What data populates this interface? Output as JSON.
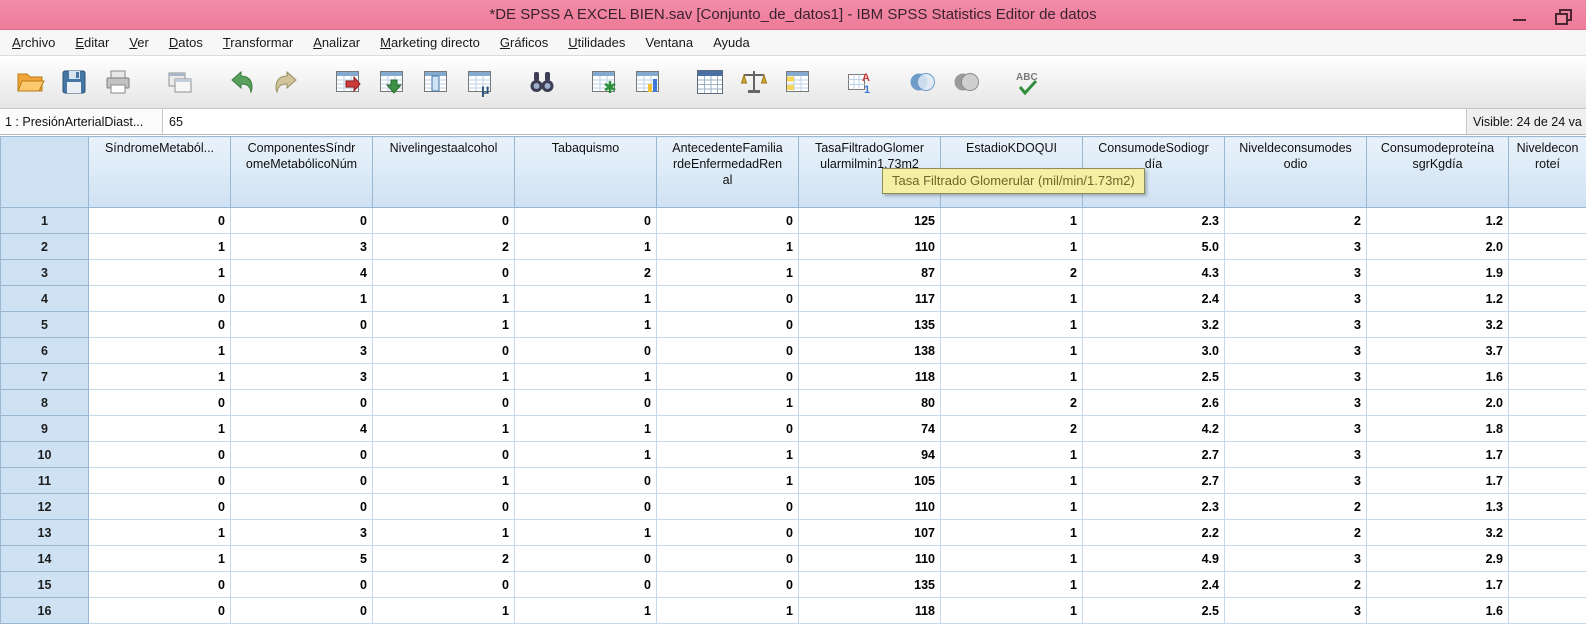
{
  "window": {
    "title": "*DE SPSS A EXCEL BIEN.sav [Conjunto_de_datos1] - IBM SPSS Statistics Editor de datos"
  },
  "menu": {
    "items": [
      {
        "label": "Archivo",
        "underline": true
      },
      {
        "label": "Editar",
        "underline": true
      },
      {
        "label": "Ver",
        "underline": true
      },
      {
        "label": "Datos",
        "underline": true
      },
      {
        "label": "Transformar",
        "underline": true
      },
      {
        "label": "Analizar",
        "underline": true
      },
      {
        "label": "Marketing directo",
        "underline": true
      },
      {
        "label": "Gráficos",
        "underline": true
      },
      {
        "label": "Utilidades",
        "underline": true
      },
      {
        "label": "Ventana",
        "underline": false
      },
      {
        "label": "Ayuda",
        "underline": false
      }
    ]
  },
  "toolbar": {
    "icons": [
      {
        "name": "open-data-icon",
        "gap": false
      },
      {
        "name": "save-icon",
        "gap": false
      },
      {
        "name": "print-icon",
        "gap": false
      },
      {
        "name": "recall-dialogs-icon",
        "gap": true
      },
      {
        "name": "undo-icon",
        "gap": true
      },
      {
        "name": "redo-icon",
        "gap": false
      },
      {
        "name": "goto-case-icon",
        "gap": true
      },
      {
        "name": "goto-variable-icon",
        "gap": false
      },
      {
        "name": "variables-icon",
        "gap": false
      },
      {
        "name": "descriptives-icon",
        "gap": false
      },
      {
        "name": "find-icon",
        "gap": true
      },
      {
        "name": "insert-cases-icon",
        "gap": true
      },
      {
        "name": "insert-variable-icon",
        "gap": false
      },
      {
        "name": "split-file-icon",
        "gap": true
      },
      {
        "name": "weight-cases-icon",
        "gap": false
      },
      {
        "name": "value-labels-icon",
        "gap": false
      },
      {
        "name": "use-variable-sets-icon",
        "gap": true
      },
      {
        "name": "select-cases-icon",
        "gap": true
      },
      {
        "name": "aggregate-icon",
        "gap": false
      },
      {
        "name": "spell-check-icon",
        "gap": true
      }
    ]
  },
  "cell_reference": {
    "label": "1 : PresiónArterialDiast...",
    "value": "65",
    "visible_info": "Visible: 24 de 24 va"
  },
  "tooltip": {
    "text": "Tasa Filtrado Glomerular (mil/min/1.73m2)"
  },
  "grid": {
    "columns": [
      {
        "name": "SíndromeMetabólico",
        "lines": [
          "SíndromeMetaból..."
        ]
      },
      {
        "name": "ComponentesSíndromeMetabólicoNúm",
        "lines": [
          "ComponentesSíndr",
          "omeMetabólicoNúm"
        ]
      },
      {
        "name": "Nivelingestaalcohol",
        "lines": [
          "Nivelingestaalcohol"
        ]
      },
      {
        "name": "Tabaquismo",
        "lines": [
          "Tabaquismo"
        ]
      },
      {
        "name": "AntecedenteFamiliardeEnfermedadRenal",
        "lines": [
          "AntecedenteFamilia",
          "rdeEnfermedadRen",
          "al"
        ]
      },
      {
        "name": "TasaFiltradoGlomerularmilmin1.73m2",
        "lines": [
          "TasaFiltradoGlomer",
          "ularmilmin1.73m2"
        ]
      },
      {
        "name": "EstadioKDOQUI",
        "lines": [
          "EstadioKDOQUI"
        ]
      },
      {
        "name": "ConsumodeSodiogrdía",
        "lines": [
          "ConsumodeSodiogr",
          "día"
        ]
      },
      {
        "name": "Niveldeconsumodesodio",
        "lines": [
          "Niveldeconsumodes",
          "odio"
        ]
      },
      {
        "name": "ConsumodeproteínasgrKgdía",
        "lines": [
          "Consumodeproteína",
          "sgrKgdía"
        ]
      },
      {
        "name": "Niveldeconsumodeproteínas",
        "lines": [
          "Niveldecon",
          "roteí"
        ]
      }
    ],
    "rows": [
      {
        "n": "1",
        "values": [
          "0",
          "0",
          "0",
          "0",
          "0",
          "125",
          "1",
          "2.3",
          "2",
          "1.2",
          ""
        ]
      },
      {
        "n": "2",
        "values": [
          "1",
          "3",
          "2",
          "1",
          "1",
          "110",
          "1",
          "5.0",
          "3",
          "2.0",
          ""
        ]
      },
      {
        "n": "3",
        "values": [
          "1",
          "4",
          "0",
          "2",
          "1",
          "87",
          "2",
          "4.3",
          "3",
          "1.9",
          ""
        ]
      },
      {
        "n": "4",
        "values": [
          "0",
          "1",
          "1",
          "1",
          "0",
          "117",
          "1",
          "2.4",
          "3",
          "1.2",
          ""
        ]
      },
      {
        "n": "5",
        "values": [
          "0",
          "0",
          "1",
          "1",
          "0",
          "135",
          "1",
          "3.2",
          "3",
          "3.2",
          ""
        ]
      },
      {
        "n": "6",
        "values": [
          "1",
          "3",
          "0",
          "0",
          "0",
          "138",
          "1",
          "3.0",
          "3",
          "3.7",
          ""
        ]
      },
      {
        "n": "7",
        "values": [
          "1",
          "3",
          "1",
          "1",
          "0",
          "118",
          "1",
          "2.5",
          "3",
          "1.6",
          ""
        ]
      },
      {
        "n": "8",
        "values": [
          "0",
          "0",
          "0",
          "0",
          "1",
          "80",
          "2",
          "2.6",
          "3",
          "2.0",
          ""
        ]
      },
      {
        "n": "9",
        "values": [
          "1",
          "4",
          "1",
          "1",
          "0",
          "74",
          "2",
          "4.2",
          "3",
          "1.8",
          ""
        ]
      },
      {
        "n": "10",
        "values": [
          "0",
          "0",
          "0",
          "1",
          "1",
          "94",
          "1",
          "2.7",
          "3",
          "1.7",
          ""
        ]
      },
      {
        "n": "11",
        "values": [
          "0",
          "0",
          "1",
          "0",
          "1",
          "105",
          "1",
          "2.7",
          "3",
          "1.7",
          ""
        ]
      },
      {
        "n": "12",
        "values": [
          "0",
          "0",
          "0",
          "0",
          "0",
          "110",
          "1",
          "2.3",
          "2",
          "1.3",
          ""
        ]
      },
      {
        "n": "13",
        "values": [
          "1",
          "3",
          "1",
          "1",
          "0",
          "107",
          "1",
          "2.2",
          "2",
          "3.2",
          ""
        ]
      },
      {
        "n": "14",
        "values": [
          "1",
          "5",
          "2",
          "0",
          "0",
          "110",
          "1",
          "4.9",
          "3",
          "2.9",
          ""
        ]
      },
      {
        "n": "15",
        "values": [
          "0",
          "0",
          "0",
          "0",
          "0",
          "135",
          "1",
          "2.4",
          "2",
          "1.7",
          ""
        ]
      },
      {
        "n": "16",
        "values": [
          "0",
          "0",
          "1",
          "1",
          "1",
          "118",
          "1",
          "2.5",
          "3",
          "1.6",
          ""
        ]
      }
    ]
  },
  "colors": {
    "titlebar_top": "#f28da7",
    "titlebar_bottom": "#ee7b99",
    "header_bg": "#cfe2f3",
    "grid_border": "#9bb8d3",
    "cell_border": "#c6d9ea",
    "tooltip_bg": "#f5efa3",
    "tooltip_border": "#8d8d58",
    "tooltip_text": "#6d672a"
  }
}
